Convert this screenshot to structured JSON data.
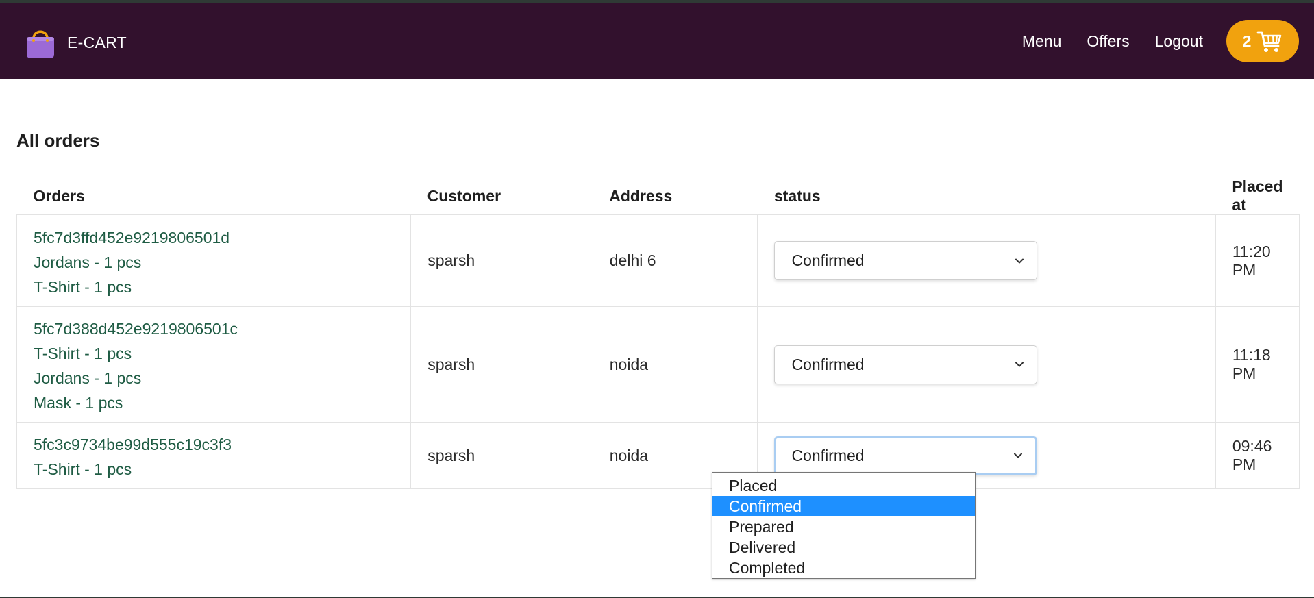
{
  "colors": {
    "navbar_bg": "#32112d",
    "cart_bg": "#f1a20e",
    "link_green": "#1f5c44",
    "option_highlight": "#1e90ff"
  },
  "header": {
    "brand_icon": "shopping-bag-icon",
    "brand_name": "E-CART",
    "nav": [
      "Menu",
      "Offers",
      "Logout"
    ],
    "cart_count": "2",
    "cart_icon": "shopping-cart-icon"
  },
  "main": {
    "title": "All orders",
    "columns": [
      "Orders",
      "Customer",
      "Address",
      "status",
      "Placed at"
    ],
    "rows": [
      {
        "order_id": "5fc7d3ffd452e9219806501d",
        "items": [
          "Jordans - 1 pcs",
          "T-Shirt - 1 pcs"
        ],
        "customer": "sparsh",
        "address": "delhi 6",
        "status": "Confirmed",
        "placed_at": "11:20 PM"
      },
      {
        "order_id": "5fc7d388d452e9219806501c",
        "items": [
          "T-Shirt - 1 pcs",
          "Jordans - 1 pcs",
          "Mask - 1 pcs"
        ],
        "customer": "sparsh",
        "address": "noida",
        "status": "Confirmed",
        "placed_at": "11:18 PM"
      },
      {
        "order_id": "5fc3c9734be99d555c19c3f3",
        "items": [
          "T-Shirt - 1 pcs"
        ],
        "customer": "sparsh",
        "address": "noida",
        "status": "Confirmed",
        "placed_at": "09:46 PM"
      }
    ],
    "status_options": [
      "Placed",
      "Confirmed",
      "Prepared",
      "Delivered",
      "Completed"
    ],
    "open_dropdown_selected": "Confirmed"
  }
}
